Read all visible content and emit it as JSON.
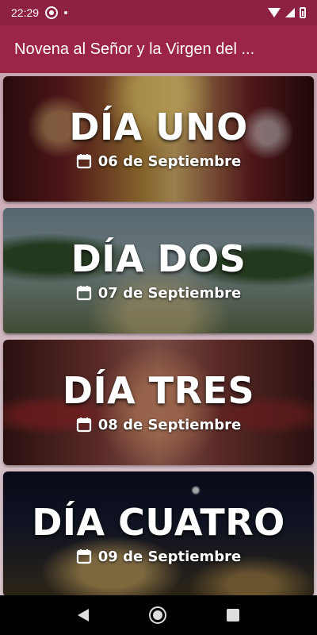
{
  "status_bar": {
    "time": "22:29"
  },
  "app_bar": {
    "title": "Novena al Señor y la Virgen del ..."
  },
  "days": [
    {
      "title": "DÍA UNO",
      "date": "06 de Septiembre"
    },
    {
      "title": "DÍA DOS",
      "date": "07 de Septiembre"
    },
    {
      "title": "DÍA TRES",
      "date": "08 de Septiembre"
    },
    {
      "title": "DÍA CUATRO",
      "date": "09 de Septiembre"
    }
  ],
  "icons": {
    "status": [
      "whatsapp-icon",
      "dot-icon",
      "wifi-icon",
      "signal-icon",
      "battery-icon"
    ],
    "card": "calendar-icon",
    "nav": [
      "back-icon",
      "home-icon",
      "recents-icon"
    ]
  },
  "colors": {
    "status_bar": "#8d2142",
    "app_bar": "#9c2447",
    "card_text": "#ffffff"
  }
}
